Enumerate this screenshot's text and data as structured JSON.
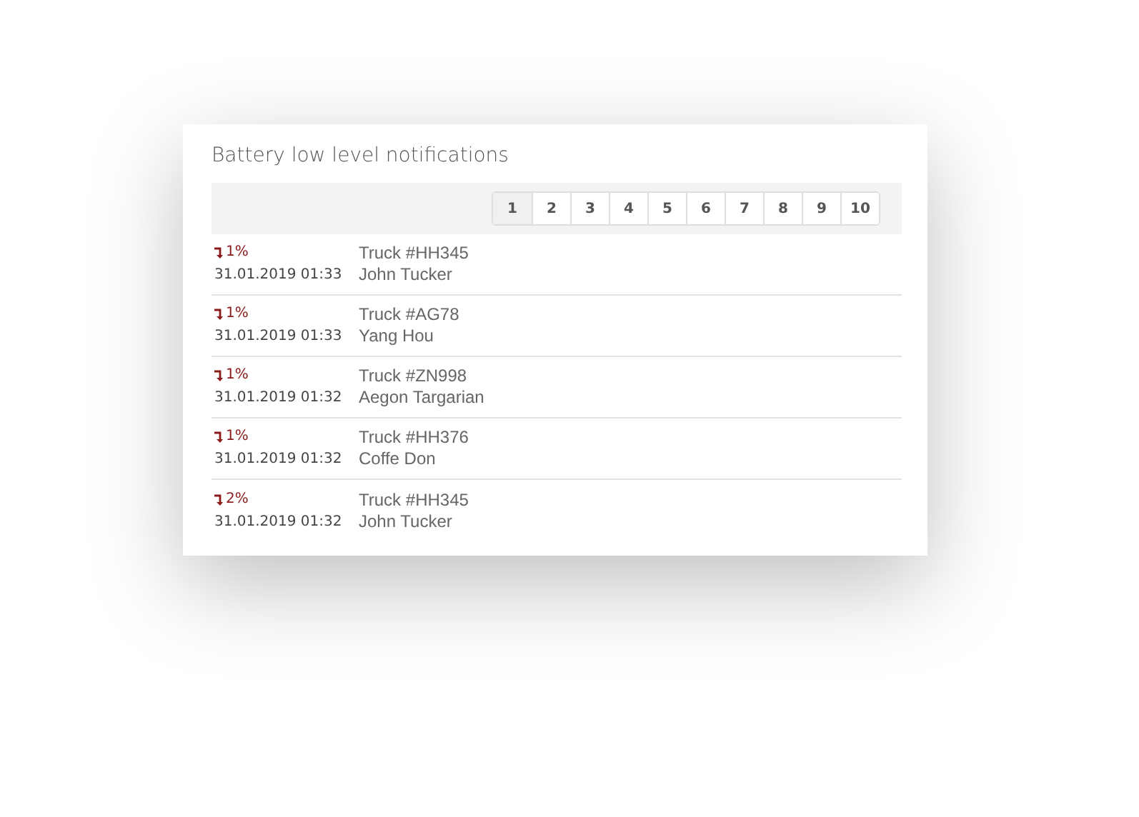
{
  "title": "Battery low level notifications",
  "pagination": [
    {
      "label": "1",
      "selected": true
    },
    {
      "label": "2",
      "selected": false
    },
    {
      "label": "3",
      "selected": false
    },
    {
      "label": "4",
      "selected": false
    },
    {
      "label": "5",
      "selected": false
    },
    {
      "label": "6",
      "selected": false
    },
    {
      "label": "7",
      "selected": false
    },
    {
      "label": "8",
      "selected": false
    },
    {
      "label": "9",
      "selected": false
    },
    {
      "label": "10",
      "selected": false
    }
  ],
  "notifications": [
    {
      "level": "1%",
      "time": "31.01.2019 01:33",
      "vehicle": "Truck #HH345",
      "driver": "John Tucker"
    },
    {
      "level": "1%",
      "time": "31.01.2019 01:33",
      "vehicle": "Truck #AG78",
      "driver": "Yang Hou"
    },
    {
      "level": "1%",
      "time": "31.01.2019 01:32",
      "vehicle": "Truck #ZN998",
      "driver": "Aegon Targarian"
    },
    {
      "level": "1%",
      "time": "31.01.2019 01:32",
      "vehicle": "Truck #HH376",
      "driver": "Coffe Don"
    },
    {
      "level": "2%",
      "time": "31.01.2019 01:32",
      "vehicle": "Truck #HH345",
      "driver": "John Tucker"
    }
  ]
}
